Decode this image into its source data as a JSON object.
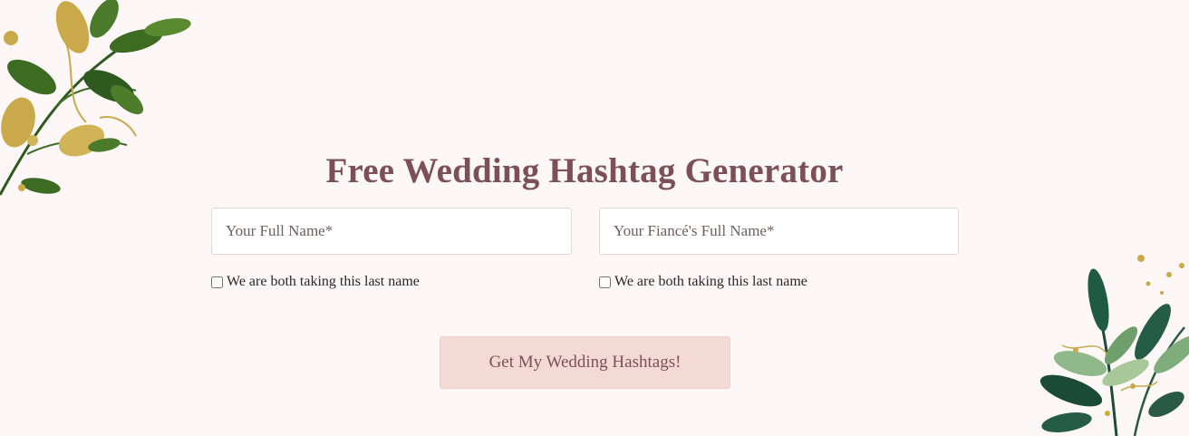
{
  "page": {
    "title": "Free Wedding Hashtag Generator"
  },
  "form": {
    "name_field": {
      "placeholder": "Your Full Name*",
      "value": ""
    },
    "fiance_field": {
      "placeholder": "Your Fiancé's Full Name*",
      "value": ""
    },
    "checkbox_1_label": "We are both taking this last name",
    "checkbox_2_label": "We are both taking this last name",
    "submit_label": "Get My Wedding Hashtags!"
  },
  "decorations": {
    "top_left": "leafy-branch-gold-green",
    "bottom_right": "eucalyptus-gold-green"
  },
  "colors": {
    "background": "#fdf8f7",
    "title": "#7d5058",
    "button_bg": "#f4dad5",
    "button_text": "#7d5058"
  }
}
